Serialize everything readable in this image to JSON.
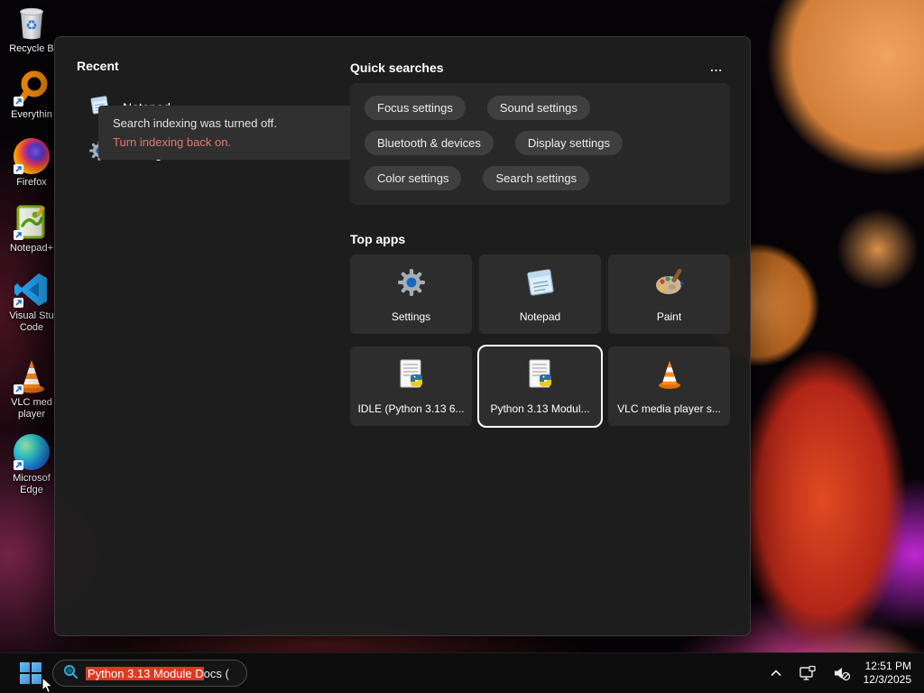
{
  "desktop": {
    "icons": [
      {
        "name": "recycle-bin",
        "label": "Recycle B"
      },
      {
        "name": "everything",
        "label": "Everythin"
      },
      {
        "name": "firefox",
        "label": "Firefox"
      },
      {
        "name": "notepad-plus-plus",
        "label": "Notepad+"
      },
      {
        "name": "visual-studio-code",
        "label": "Visual Stu Code"
      },
      {
        "name": "vlc-media-player",
        "label": "VLC med player"
      },
      {
        "name": "microsoft-edge",
        "label": "Microsof Edge"
      }
    ]
  },
  "panel": {
    "recent": {
      "title": "Recent",
      "items": [
        {
          "label": "Notepad"
        },
        {
          "label": "Settings"
        }
      ]
    },
    "quick_searches": {
      "title": "Quick searches",
      "more": "...",
      "pills": [
        "Focus settings",
        "Sound settings",
        "Bluetooth & devices",
        "Display settings",
        "Color settings",
        "Search settings"
      ]
    },
    "top_apps": {
      "title": "Top apps",
      "tiles": [
        {
          "label": "Settings",
          "selected": false
        },
        {
          "label": "Notepad",
          "selected": false
        },
        {
          "label": "Paint",
          "selected": false
        },
        {
          "label": "IDLE (Python 3.13 6...",
          "selected": false
        },
        {
          "label": "Python 3.13 Modul...",
          "selected": true
        },
        {
          "label": "VLC media player s...",
          "selected": false
        }
      ]
    },
    "indexing_notice": {
      "message": "Search indexing was turned off.",
      "action": "Turn indexing back on."
    }
  },
  "taskbar": {
    "search_box": {
      "value_highlighted": "Python 3.13 Module D",
      "value_rest": "ocs ("
    },
    "tray": {
      "time": "12:51 PM",
      "date": "12/3/2025"
    }
  },
  "colors": {
    "selection_highlight": "#e0391f",
    "notice_link": "#dd7a70",
    "selected_tile_border": "#ffffff",
    "taskbar_bg": "#0d0d0d",
    "panel_bg": "#1e1e1e"
  }
}
